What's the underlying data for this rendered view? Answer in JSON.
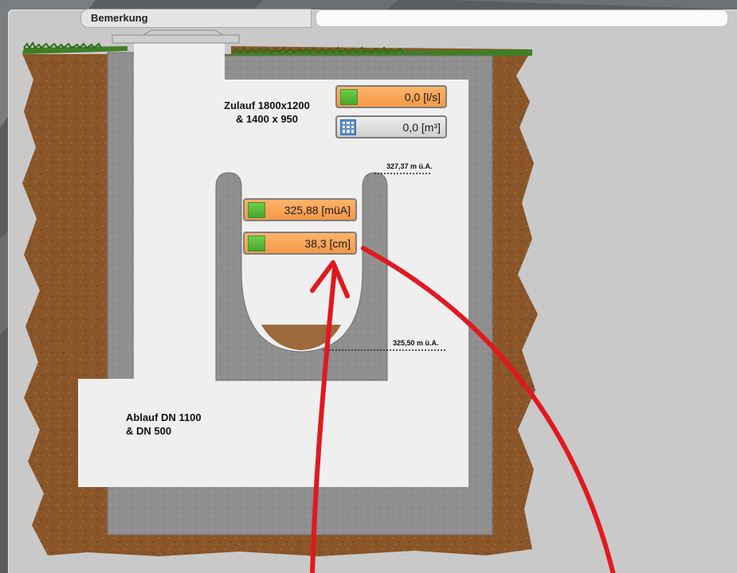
{
  "remark": {
    "label": "Bemerkung",
    "value": ""
  },
  "diagram": {
    "inlet_label": "Zulauf 1800x1200\n& 1400 x 950",
    "outlet_label": "Ablauf DN 1100\n& DN 500",
    "level_top": "327,37 m ü.A.",
    "level_bottom": "325,50 m ü.A."
  },
  "readouts": {
    "flow": {
      "value": "0,0 [l/s]"
    },
    "volume": {
      "value": "0,0 [m³]"
    },
    "water_level": {
      "value": "325,88 [müA]"
    },
    "fill_height": {
      "value": "38,3 [cm]"
    }
  },
  "colors": {
    "readout_orange": "#f7a255",
    "indicator_green": "#56b935",
    "annotation_red": "#e0191f",
    "soil": "#8a5528",
    "concrete": "#8e8e8e",
    "sediment": "#9c6a3c"
  },
  "icons": {
    "volume_icon": "calculator-icon",
    "status_indicator": "green-status-indicator"
  }
}
